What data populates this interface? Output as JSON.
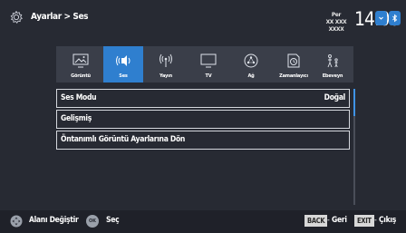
{
  "header": {
    "breadcrumb": "Ayarlar > Ses",
    "day": "Per",
    "date": "XX XXX XXXX",
    "time": "14:00",
    "icon": "gear-icon",
    "buttons": [
      "chevron-down-icon",
      "bluetooth-icon"
    ]
  },
  "menu": {
    "items": [
      {
        "label": "Görüntü",
        "icon": "picture-icon"
      },
      {
        "label": "Ses",
        "icon": "sound-icon",
        "active": true
      },
      {
        "label": "Yayın",
        "icon": "broadcast-icon"
      },
      {
        "label": "TV",
        "icon": "tv-icon"
      },
      {
        "label": "Ağ",
        "icon": "network-icon"
      },
      {
        "label": "Zamanlayıcı",
        "icon": "timer-icon"
      },
      {
        "label": "Ebeveyn",
        "icon": "parental-icon"
      }
    ]
  },
  "list": {
    "rows": [
      {
        "label": "Ses Modu",
        "value": "Doğal"
      },
      {
        "label": "Gelişmiş",
        "value": ""
      },
      {
        "label": "Öntanımlı Görüntü Ayarlarına Dön",
        "value": ""
      }
    ]
  },
  "footer": {
    "change_area": "Alanı Değiştir",
    "ok_key": "OK",
    "select": "Seç",
    "back_key": "BACK",
    "back": "Geri",
    "exit_key": "EXIT",
    "exit": "Çıkış"
  },
  "colors": {
    "background": "#272a33",
    "menu_bg": "#3a3e49",
    "accent": "#2f7fcf",
    "footer_bg": "#1f2129"
  }
}
